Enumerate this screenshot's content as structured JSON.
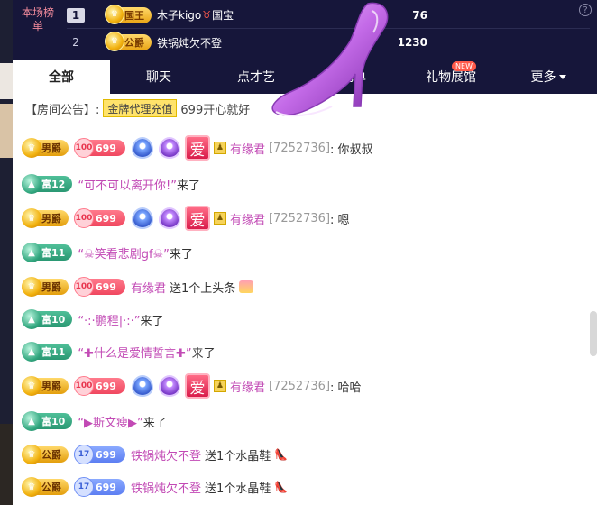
{
  "rank": {
    "title": "本场榜单",
    "rows": [
      {
        "num": "1",
        "badge": "国王",
        "name": "木子kigo",
        "title_tag": "国宝",
        "score": "76"
      },
      {
        "num": "2",
        "badge": "公爵",
        "name": "铁锅炖欠不登",
        "score": "1230"
      }
    ],
    "help": "?"
  },
  "tabs": [
    {
      "label": "全部"
    },
    {
      "label": "聊天"
    },
    {
      "label": "点才艺"
    },
    {
      "label": "礼单"
    },
    {
      "label": "礼物展馆",
      "badge": "NEW"
    },
    {
      "label": "更多"
    }
  ],
  "announce": {
    "prefix": "【房间公告】:",
    "button": "金牌代理充值",
    "text": "699开心就好"
  },
  "messages": [
    {
      "badge": "男爵",
      "fans_level": "100",
      "fans": "699",
      "name": "有缘君",
      "id": "[7252736]",
      "text": ":  你叔叔"
    },
    {
      "badge": "富12",
      "quote": "“可不可以离开你!”",
      "text": "来了"
    },
    {
      "badge": "男爵",
      "fans_level": "100",
      "fans": "699",
      "name": "有缘君",
      "id": "[7252736]",
      "text": ":  嗯"
    },
    {
      "badge": "富11",
      "quote": "“☠笑看悲剧gf☠”",
      "text": "来了"
    },
    {
      "badge": "男爵",
      "fans_level": "100",
      "fans": "699",
      "name": "有缘君",
      "text": "送1个上头条"
    },
    {
      "badge": "富10",
      "quote": "“·:·鹏程|·:·”",
      "text": "来了"
    },
    {
      "badge": "富11",
      "quote": "“✚什么是爱情誓言✚”",
      "text": "来了"
    },
    {
      "badge": "男爵",
      "fans_level": "100",
      "fans": "699",
      "name": "有缘君",
      "id": "[7252736]",
      "text": ":  哈哈"
    },
    {
      "badge": "富10",
      "quote": "“▶斯文瘦▶”",
      "text": "来了"
    },
    {
      "badge": "公爵",
      "fans_level": "17",
      "fans": "699",
      "name": "铁锅炖欠不登",
      "text": "送1个水晶鞋"
    },
    {
      "badge": "公爵",
      "fans_level": "17",
      "fans": "699",
      "name": "铁锅炖欠不登",
      "text": "送1个水晶鞋"
    }
  ],
  "colors": {
    "header_bg": "#16163a",
    "username": "#c24ab5"
  }
}
